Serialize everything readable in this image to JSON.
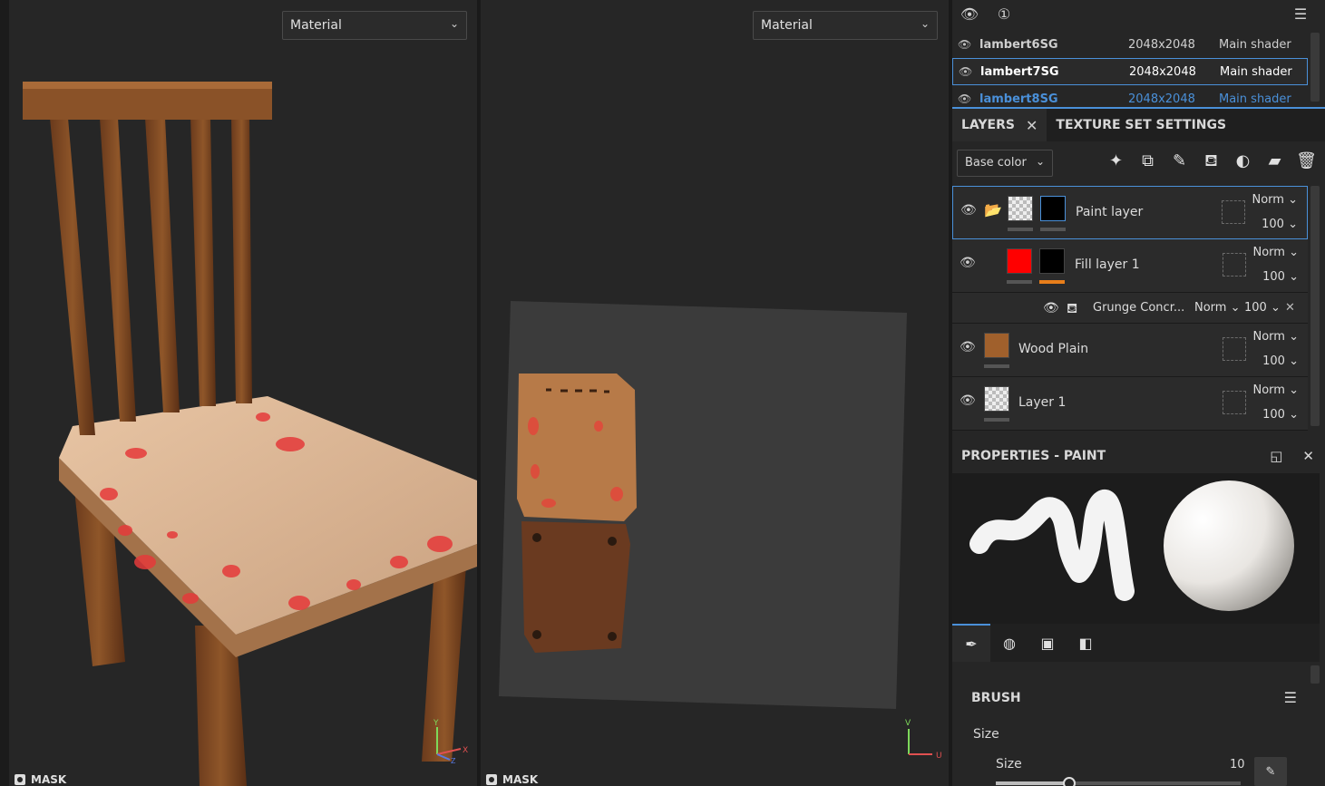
{
  "viewport_3d": {
    "mode": "Material",
    "mask_label": "MASK",
    "axis": {
      "y": "Y",
      "x": "X",
      "z": "Z"
    }
  },
  "viewport_2d": {
    "mode": "Material",
    "mask_label": "MASK",
    "axis": {
      "v": "V",
      "u": "U"
    }
  },
  "texture_sets": [
    {
      "name": "lambert6SG",
      "resolution": "2048x2048",
      "shader": "Main shader",
      "selected": false
    },
    {
      "name": "lambert7SG",
      "resolution": "2048x2048",
      "shader": "Main shader",
      "selected": true
    },
    {
      "name": "lambert8SG",
      "resolution": "2048x2048",
      "shader": "Main shader",
      "selected": false
    }
  ],
  "tabs": {
    "layers": "LAYERS",
    "texture_set_settings": "TEXTURE SET SETTINGS"
  },
  "channel": "Base color",
  "toolbar_icons": [
    "magic-wand-icon",
    "add-mask-icon",
    "paint-brush-icon",
    "fill-bucket-icon",
    "smart-material-icon",
    "folder-icon",
    "trash-icon"
  ],
  "layers": [
    {
      "name": "Paint layer",
      "blend": "Norm",
      "opacity": "100",
      "selected": true
    },
    {
      "name": "Fill layer 1",
      "blend": "Norm",
      "opacity": "100",
      "selected": false,
      "color": "#ff0000"
    },
    {
      "name": "Wood Plain",
      "blend": "Norm",
      "opacity": "100",
      "selected": false
    },
    {
      "name": "Layer 1",
      "blend": "Norm",
      "opacity": "100",
      "selected": false
    }
  ],
  "effect": {
    "name": "Grunge Concr...",
    "blend": "Norm",
    "opacity": "100"
  },
  "properties": {
    "title": "PROPERTIES - PAINT"
  },
  "brush": {
    "title": "BRUSH",
    "size_group": "Size",
    "size_label": "Size",
    "size_value": "10",
    "size_fraction": 0.3
  },
  "colors": {
    "accent": "#4a90d9",
    "fill_color": "#ff0000",
    "orange_bar": "#e87e1a"
  }
}
